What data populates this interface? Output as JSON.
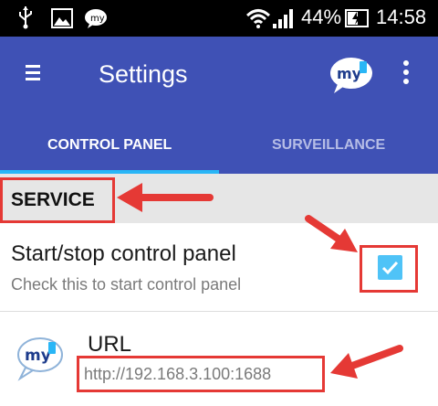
{
  "status_bar": {
    "battery_percent": "44%",
    "time": "14:58",
    "icons": [
      "usb-icon",
      "image-icon",
      "my-app-notification-icon",
      "wifi-icon",
      "signal-icon",
      "battery-charging-icon"
    ]
  },
  "app_bar": {
    "title": "Settings",
    "logo_text": "my",
    "icons": [
      "menu-icon",
      "app-logo-icon",
      "overflow-menu-icon"
    ]
  },
  "tabs": [
    {
      "label": "CONTROL PANEL",
      "selected": true
    },
    {
      "label": "SURVEILLANCE",
      "selected": false
    }
  ],
  "section": {
    "title": "SERVICE"
  },
  "preferences": [
    {
      "title": "Start/stop control panel",
      "summary": "Check this to start control panel",
      "checked": true
    },
    {
      "title": "URL",
      "summary": "http://192.168.3.100:1688",
      "icon": "my-app-logo-icon"
    }
  ],
  "colors": {
    "app_bar": "#3f51b5",
    "tab_indicator": "#29b6f6",
    "checkbox": "#4fc3f7",
    "annotation": "#e53935"
  }
}
